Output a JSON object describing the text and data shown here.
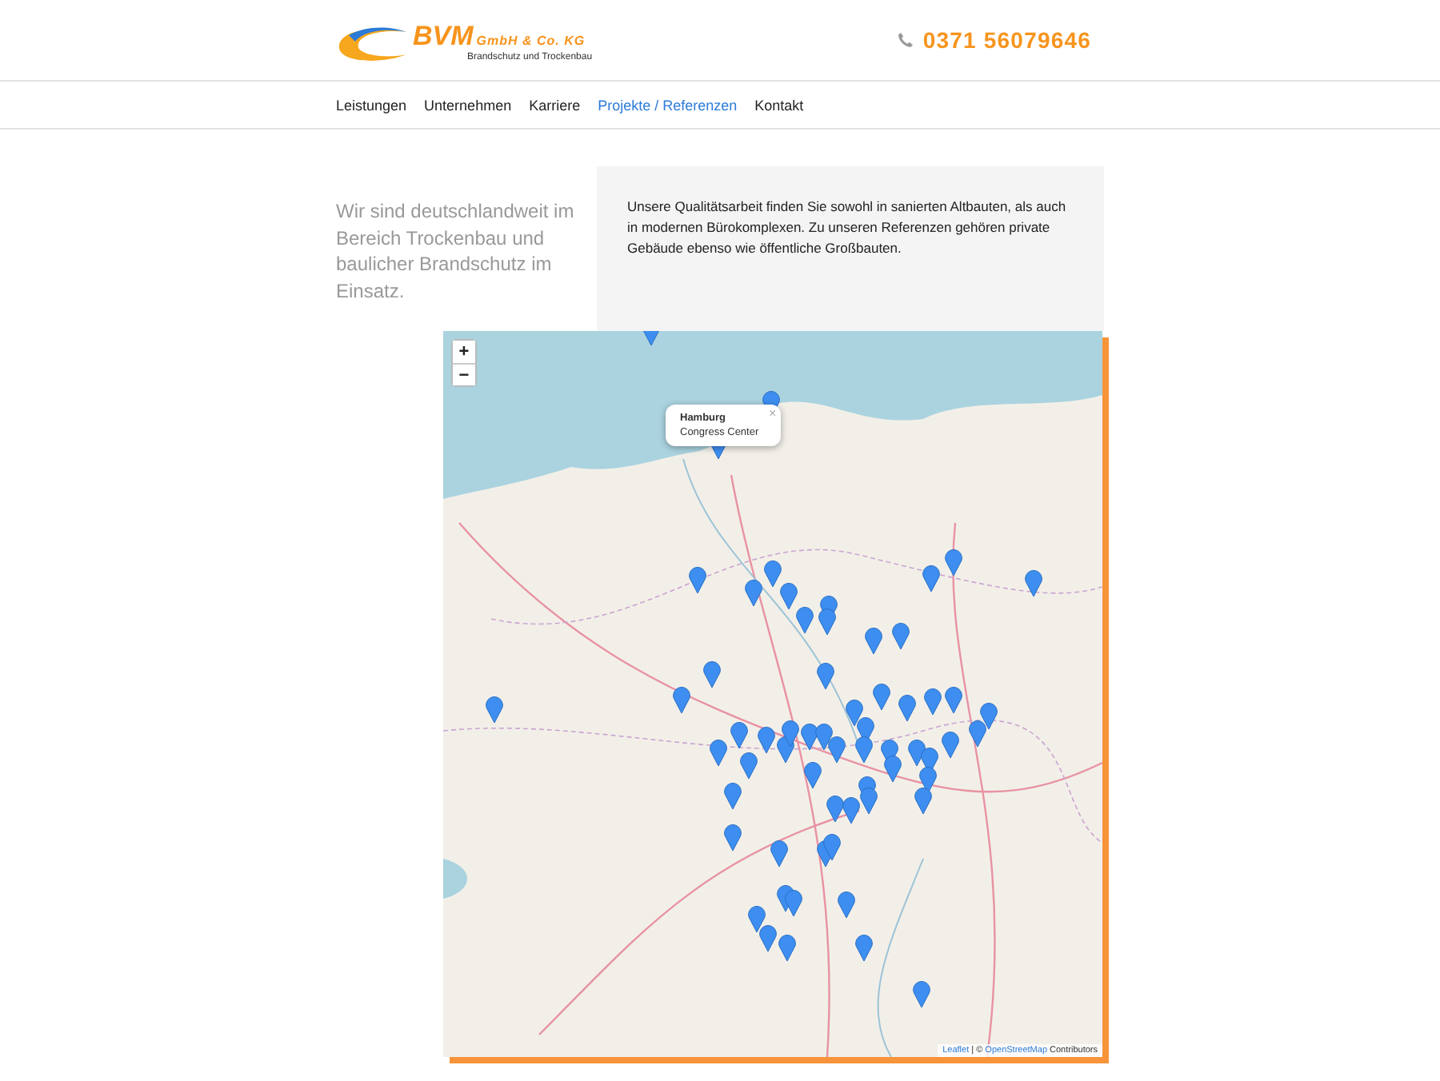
{
  "logo": {
    "name": "BVM",
    "suffix": "GmbH & Co. KG",
    "tagline": "Brandschutz und Trockenbau"
  },
  "phone": "0371 56079646",
  "nav": [
    {
      "label": "Leistungen",
      "selected": false
    },
    {
      "label": "Unternehmen",
      "selected": false
    },
    {
      "label": "Karriere",
      "selected": false
    },
    {
      "label": "Projekte / Referenzen",
      "selected": true
    },
    {
      "label": "Kontakt",
      "selected": false
    }
  ],
  "intro": {
    "lead": "Wir sind deutschlandweit im Bereich Trockenbau und baulicher Brandschutz im Einsatz.",
    "text": "Unsere Qualitätsarbeit finden Sie sowohl in sanierten Altbauten, als auch in modernen Bürokomplexen. Zu unseren Referenzen gehören private Gebäude ebenso wie öffentliche Großbauten."
  },
  "map": {
    "zoom_in": "+",
    "zoom_out": "−",
    "popup": {
      "title": "Hamburg",
      "subtitle": "Congress Center",
      "close": "×"
    },
    "attribution": {
      "library": "Leaflet",
      "separator": "| ©",
      "source": "OpenStreetMap",
      "suffix": "Contributors"
    }
  }
}
